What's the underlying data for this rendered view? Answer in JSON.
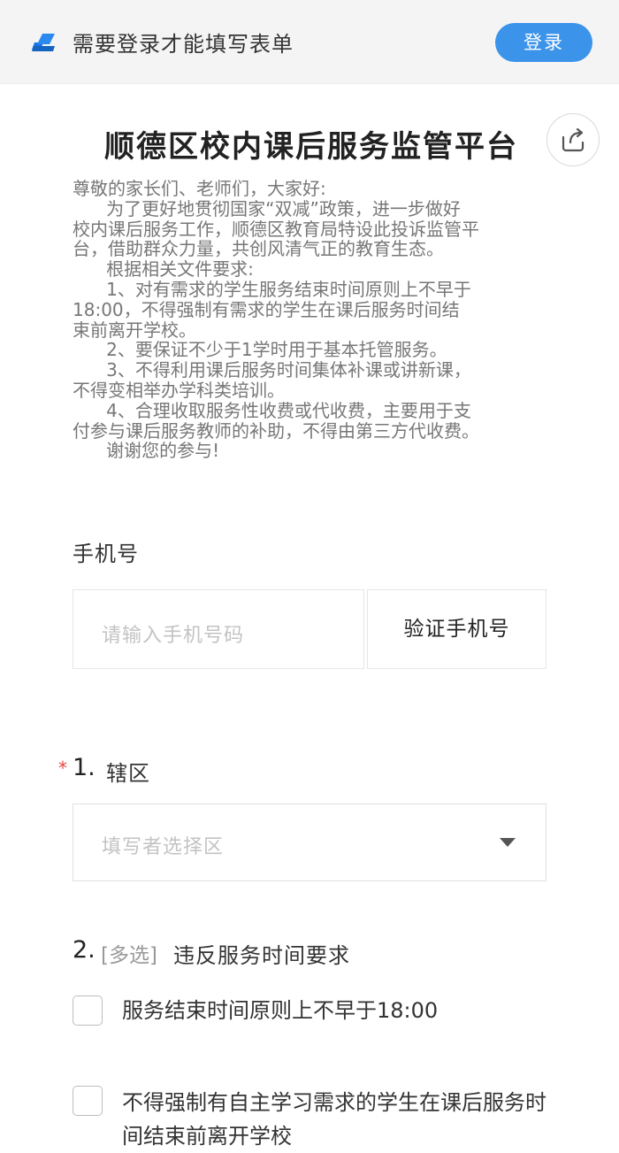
{
  "topbar": {
    "notice": "需要登录才能填写表单",
    "login_label": "登录"
  },
  "page": {
    "title": "顺德区校内课后服务监管平台",
    "intro": [
      "尊敬的家长们、老师们，大家好:",
      "      为了更好地贯彻国家“双减”政策，进一步做好",
      "校内课后服务工作，顺德区教育局特设此投诉监管平",
      "台，借助群众力量，共创风清气正的教育生态。",
      "      根据相关文件要求:",
      "      1、对有需求的学生服务结束时间原则上不早于",
      "18:00，不得强制有需求的学生在课后服务时间结",
      "束前离开学校。",
      "      2、要保证不少于1学时用于基本托管服务。",
      "      3、不得利用课后服务时间集体补课或讲新课，",
      "不得变相举办学科类培训。",
      "      4、合理收取服务性收费或代收费，主要用于支",
      "付参与课后服务教师的补助，不得由第三方代收费。",
      "      谢谢您的参与!"
    ]
  },
  "phone": {
    "label": "手机号",
    "placeholder": "请输入手机号码",
    "verify_label": "验证手机号"
  },
  "q1": {
    "required_mark": "*",
    "number": "1.",
    "title": "辖区",
    "placeholder": "填写者选择区"
  },
  "q2": {
    "number": "2.",
    "tag": "[多选]",
    "title": "违反服务时间要求",
    "options": [
      "服务结束时间原则上不早于18:00",
      "不得强制有自主学习需求的学生在课后服务时间结束前离开学校"
    ]
  },
  "icons": {
    "logo": "form-logo-icon",
    "share": "share-icon",
    "dropdown": "caret-down-icon"
  },
  "colors": {
    "accent": "#3b93ea",
    "required": "#e64340"
  }
}
